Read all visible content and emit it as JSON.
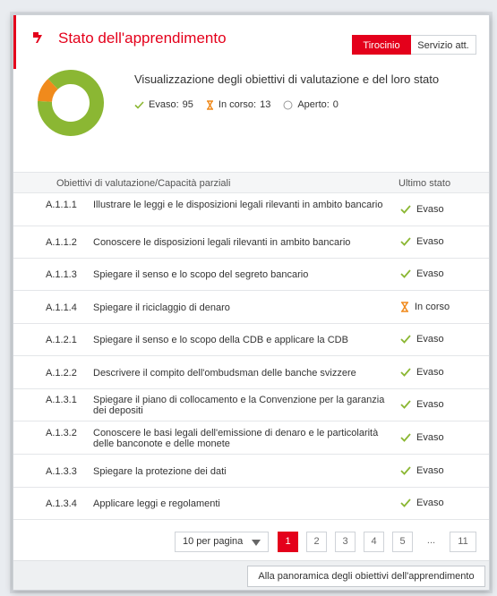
{
  "header": {
    "title": "Stato dell'apprendimento",
    "tabs": [
      {
        "label": "Tirocinio",
        "active": true
      },
      {
        "label": "Servizio att.",
        "active": false
      }
    ]
  },
  "summary": {
    "description": "Visualizzazione degli obiettivi di valutazione e del loro stato",
    "stats": [
      {
        "label": "Evaso:",
        "value": "95",
        "icon": "check-icon",
        "color": "#8bb733"
      },
      {
        "label": "In corso:",
        "value": "13",
        "icon": "hourglass-icon",
        "color": "#f08a1c"
      },
      {
        "label": "Aperto:",
        "value": "0",
        "icon": "circle-icon",
        "color": "#999999"
      }
    ],
    "donut": {
      "evaso": 95,
      "in_corso": 13,
      "aperto": 0,
      "colors": [
        "#8bb733",
        "#f08a1c",
        "#cccccc"
      ]
    }
  },
  "table": {
    "columns": [
      "Obiettivi di valutazione/Capacità parziali",
      "Ultimo stato"
    ],
    "rows": [
      {
        "code": "A.1.1.1",
        "text": "Illustrare le leggi e le disposizioni legali rilevanti in ambito bancario",
        "status": "Evaso",
        "status_icon": "check-icon"
      },
      {
        "code": "A.1.1.2",
        "text": "Conoscere le disposizioni legali rilevanti in ambito bancario",
        "status": "Evaso",
        "status_icon": "check-icon"
      },
      {
        "code": "A.1.1.3",
        "text": "Spiegare il senso e lo scopo del segreto bancario",
        "status": "Evaso",
        "status_icon": "check-icon"
      },
      {
        "code": "A.1.1.4",
        "text": "Spiegare il riciclaggio di denaro",
        "status": "In corso",
        "status_icon": "hourglass-icon"
      },
      {
        "code": "A.1.2.1",
        "text": "Spiegare il senso e lo scopo della CDB e applicare la CDB",
        "status": "Evaso",
        "status_icon": "check-icon"
      },
      {
        "code": "A.1.2.2",
        "text": "Descrivere il compito dell'ombudsman delle banche svizzere",
        "status": "Evaso",
        "status_icon": "check-icon"
      },
      {
        "code": "A.1.3.1",
        "text": "Spiegare il piano di collocamento e la Convenzione per la garanzia dei depositi",
        "status": "Evaso",
        "status_icon": "check-icon"
      },
      {
        "code": "A.1.3.2",
        "text": "Conoscere le basi legali dell'emissione di denaro e le particolarità delle banconote e delle monete",
        "status": "Evaso",
        "status_icon": "check-icon"
      },
      {
        "code": "A.1.3.3",
        "text": "Spiegare la protezione dei dati",
        "status": "Evaso",
        "status_icon": "check-icon"
      },
      {
        "code": "A.1.3.4",
        "text": "Applicare leggi e regolamenti",
        "status": "Evaso",
        "status_icon": "check-icon"
      }
    ]
  },
  "pagination": {
    "per_page": "10 per pagina",
    "pages": [
      "1",
      "2",
      "3",
      "4",
      "5",
      "...",
      "11"
    ],
    "current": "1"
  },
  "footer": {
    "overview_button": "Alla panoramica degli obiettivi dell'apprendimento"
  }
}
